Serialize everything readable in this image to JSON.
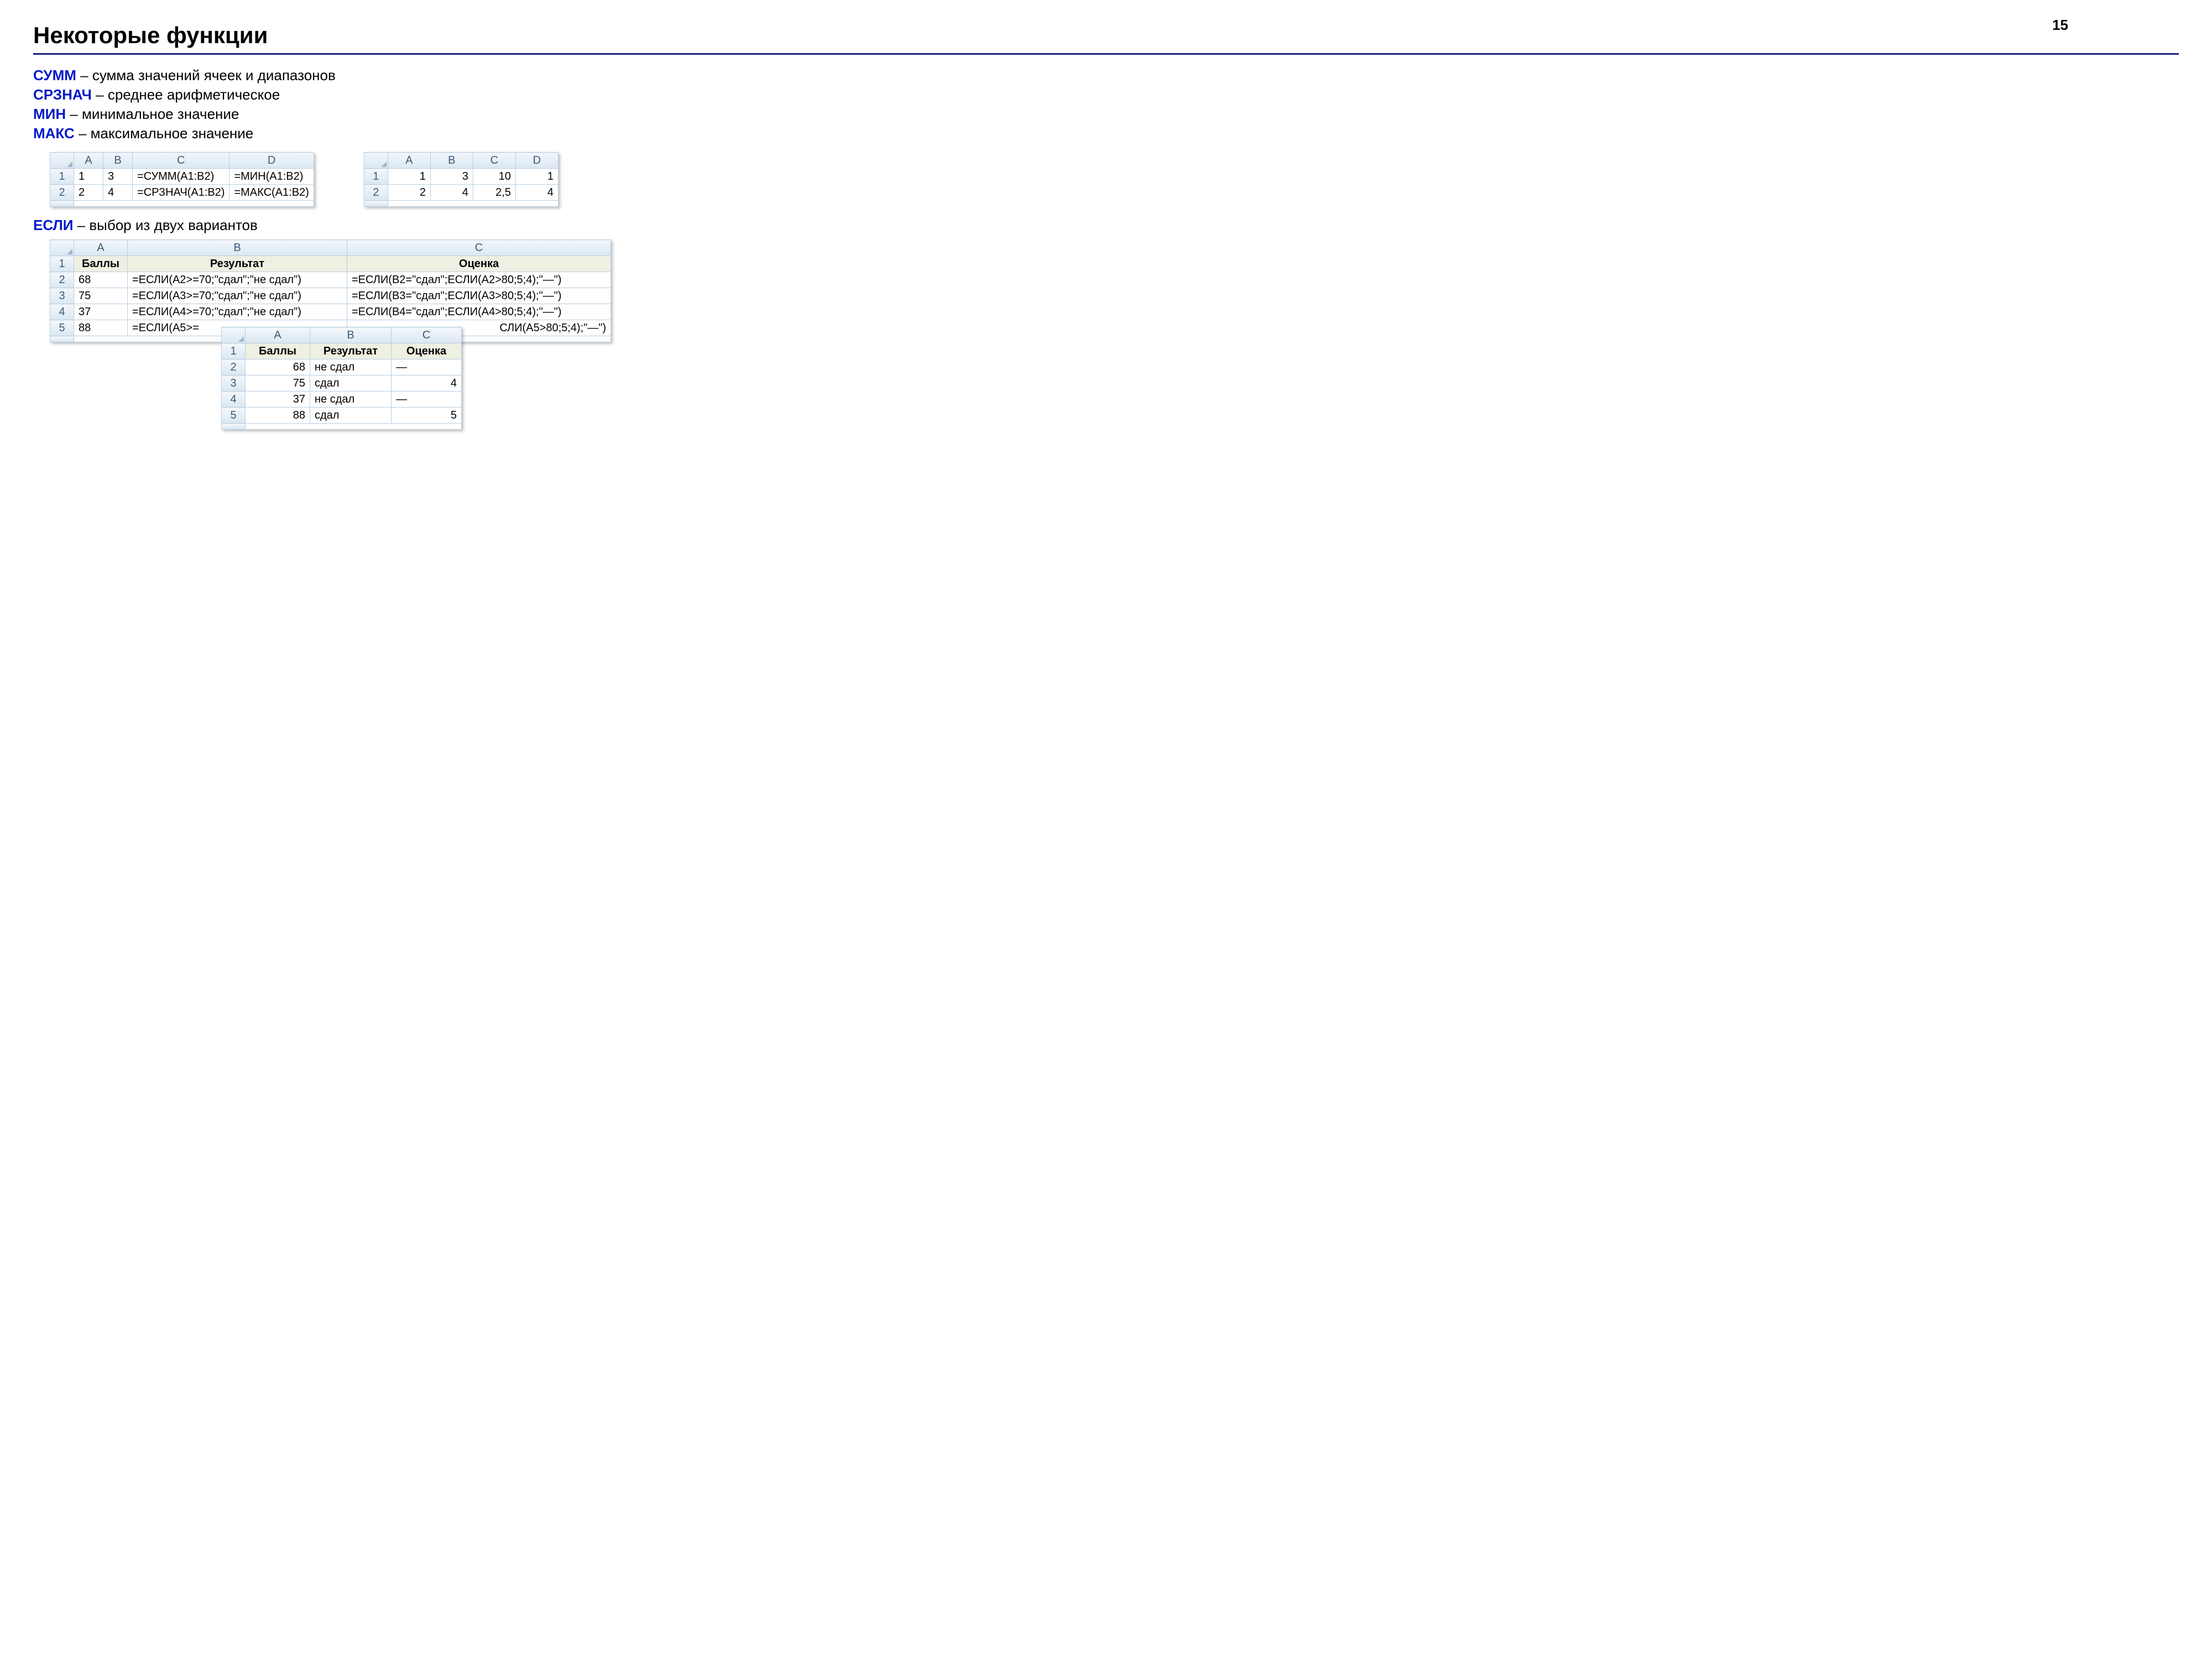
{
  "pageNumber": "15",
  "title": "Некоторые функции",
  "defs": [
    {
      "fn": "СУММ",
      "desc": " – сумма значений ячеек и диапазонов"
    },
    {
      "fn": "СРЗНАЧ",
      "desc": " – среднее арифметическое"
    },
    {
      "fn": "МИН",
      "desc": " – минимальное значение"
    },
    {
      "fn": "МАКС",
      "desc": " – максимальное значение"
    }
  ],
  "sheet1": {
    "cols": [
      "A",
      "B",
      "C",
      "D"
    ],
    "rows": [
      {
        "n": "1",
        "A": "1",
        "B": "3",
        "C": "=СУММ(A1:B2)",
        "D": "=МИН(A1:B2)"
      },
      {
        "n": "2",
        "A": "2",
        "B": "4",
        "C": "=СРЗНАЧ(A1:B2)",
        "D": "=МАКС(A1:B2)"
      }
    ]
  },
  "sheet2": {
    "cols": [
      "A",
      "B",
      "C",
      "D"
    ],
    "rows": [
      {
        "n": "1",
        "A": "1",
        "B": "3",
        "C": "10",
        "D": "1"
      },
      {
        "n": "2",
        "A": "2",
        "B": "4",
        "C": "2,5",
        "D": "4"
      }
    ]
  },
  "ifSection": {
    "fn": "ЕСЛИ",
    "desc": " – выбор из двух вариантов"
  },
  "sheet3": {
    "cols": [
      "A",
      "B",
      "C"
    ],
    "headerRow": {
      "n": "1",
      "A": "Баллы",
      "B": "Результат",
      "C": "Оценка"
    },
    "rows": [
      {
        "n": "2",
        "A": "68",
        "B": "=ЕСЛИ(A2>=70;\"сдал\";\"не сдал\")",
        "C": "=ЕСЛИ(B2=\"сдал\";ЕСЛИ(A2>80;5;4);\"—\")"
      },
      {
        "n": "3",
        "A": "75",
        "B": "=ЕСЛИ(A3>=70;\"сдал\";\"не сдал\")",
        "C": "=ЕСЛИ(B3=\"сдал\";ЕСЛИ(A3>80;5;4);\"—\")"
      },
      {
        "n": "4",
        "A": "37",
        "B": "=ЕСЛИ(A4>=70;\"сдал\";\"не сдал\")",
        "C": "=ЕСЛИ(B4=\"сдал\";ЕСЛИ(A4>80;5;4);\"—\")"
      },
      {
        "n": "5",
        "A": "88",
        "B": "=ЕСЛИ(A5>=",
        "C": "СЛИ(A5>80;5;4);\"—\")"
      }
    ]
  },
  "sheet4": {
    "cols": [
      "A",
      "B",
      "C"
    ],
    "headerRow": {
      "n": "1",
      "A": "Баллы",
      "B": "Результат",
      "C": "Оценка"
    },
    "rows": [
      {
        "n": "2",
        "A": "68",
        "B": "не сдал",
        "C": "—"
      },
      {
        "n": "3",
        "A": "75",
        "B": "сдал",
        "C": "4"
      },
      {
        "n": "4",
        "A": "37",
        "B": "не сдал",
        "C": "—"
      },
      {
        "n": "5",
        "A": "88",
        "B": "сдал",
        "C": "5"
      }
    ]
  }
}
